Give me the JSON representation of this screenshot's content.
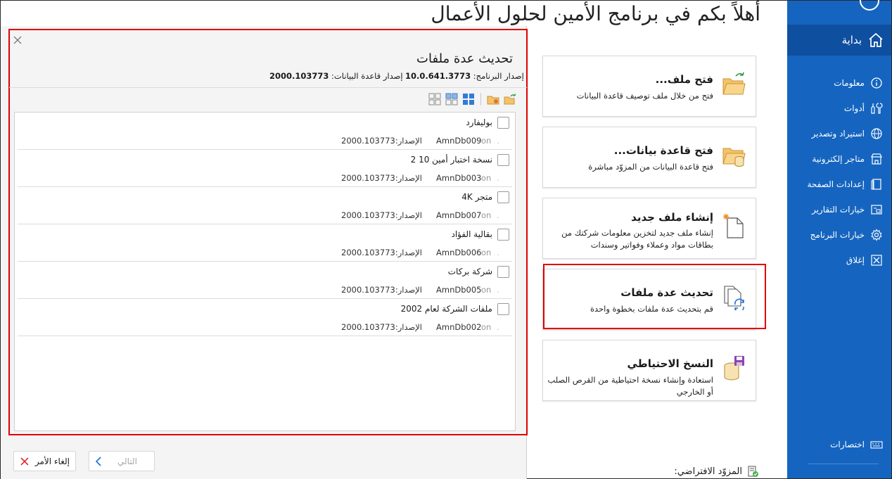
{
  "header": {
    "title": "أهلاً بكم في برنامج الأمين لحلول الأعمال"
  },
  "sidebar": {
    "home_label": "بداية",
    "items": [
      {
        "label": "معلومات",
        "icon": "info-icon"
      },
      {
        "label": "أدوات",
        "icon": "tools-icon"
      },
      {
        "label": "استيراد وتصدير",
        "icon": "globe-icon"
      },
      {
        "label": "متاجر إلكترونية",
        "icon": "store-icon"
      },
      {
        "label": "إعدادات الصفحة",
        "icon": "page-setup-icon"
      },
      {
        "label": "خيارات التقارير",
        "icon": "report-options-icon"
      },
      {
        "label": "خيارات البرنامج",
        "icon": "gear-icon"
      },
      {
        "label": "إغلاق",
        "icon": "close-box-icon"
      }
    ],
    "shortcuts_label": "اختصارات"
  },
  "cards": [
    {
      "title": "فتح ملف...",
      "desc": "فتح من خلال ملف توصيف قاعدة البيانات"
    },
    {
      "title": "فتح قاعدة بيانات...",
      "desc": "فتح قاعدة البيانات من المزوّد مباشرة"
    },
    {
      "title": "إنشاء ملف جديد",
      "desc": "إنشاء ملف جديد لتخزين معلومات شركتك من بطاقات مواد وعملاء وفواتير وسندات"
    },
    {
      "title": "تحديث عدة ملفات",
      "desc": "قم بتحديث عدة ملفات بخطوة واحدة"
    },
    {
      "title": "النسخ الاحتياطي",
      "desc": "استعادة وإنشاء نسخة احتياطية من القرص الصلب أو الخارجي"
    }
  ],
  "default_provider": "المزوّد الافتراضي:",
  "dialog": {
    "title": "تحديث عدة ملفات",
    "program_version_label": "إصدار البرنامج:",
    "program_version": "10.0.641.3773",
    "db_version_label": "إصدار قاعدة البيانات:",
    "db_version": "2000.103773",
    "rows": [
      {
        "name": "بوليفارد",
        "db": "AmnDb009",
        "on": "on",
        "version_label": "الإصدار:",
        "version": "2000.103773",
        "checked": false
      },
      {
        "name": "نسخة اختبار أمين 10 2",
        "db": "AmnDb003",
        "on": "on",
        "version_label": "الإصدار:",
        "version": "2000.103773",
        "checked": false
      },
      {
        "name": "متجر 4K",
        "db": "AmnDb007",
        "on": "on",
        "version_label": "الإصدار:",
        "version": "2000.103773",
        "checked": false
      },
      {
        "name": "بقالية الفؤاد",
        "db": "AmnDb006",
        "on": "on",
        "version_label": "الإصدار:",
        "version": "2000.103773",
        "checked": false
      },
      {
        "name": "شركة بركات",
        "db": "AmnDb005",
        "on": "on",
        "version_label": "الإصدار:",
        "version": "2000.103773",
        "checked": false
      },
      {
        "name": "ملفات الشركة لعام  2002",
        "db": "AmnDb002",
        "on": "on",
        "version_label": "الإصدار:",
        "version": "2000.103773",
        "checked": false
      }
    ],
    "next_label": "التالي",
    "cancel_label": "إلغاء الأمر"
  },
  "colors": {
    "sidebar": "#1565c0",
    "sidebar_active": "#0f4fa0",
    "highlight": "#e00000",
    "accent": "#1e6fd9"
  }
}
